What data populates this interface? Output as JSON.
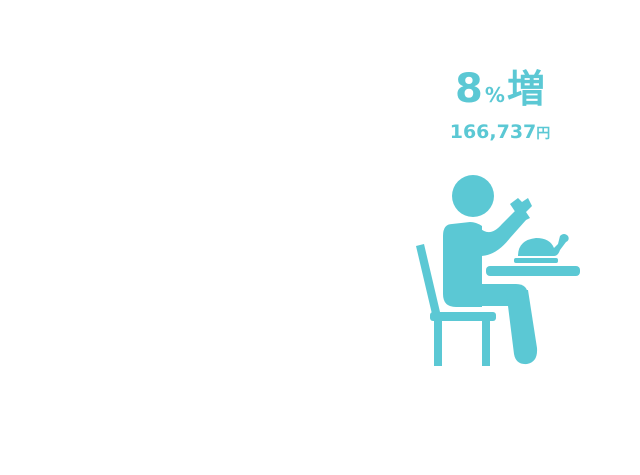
{
  "stat": {
    "number": "8",
    "percent_sign": "%",
    "increase_word": "増",
    "amount": "166,737",
    "currency": "円"
  },
  "colors": {
    "accent": "#5bc8d4"
  },
  "icon": "person-eating-at-table-icon"
}
